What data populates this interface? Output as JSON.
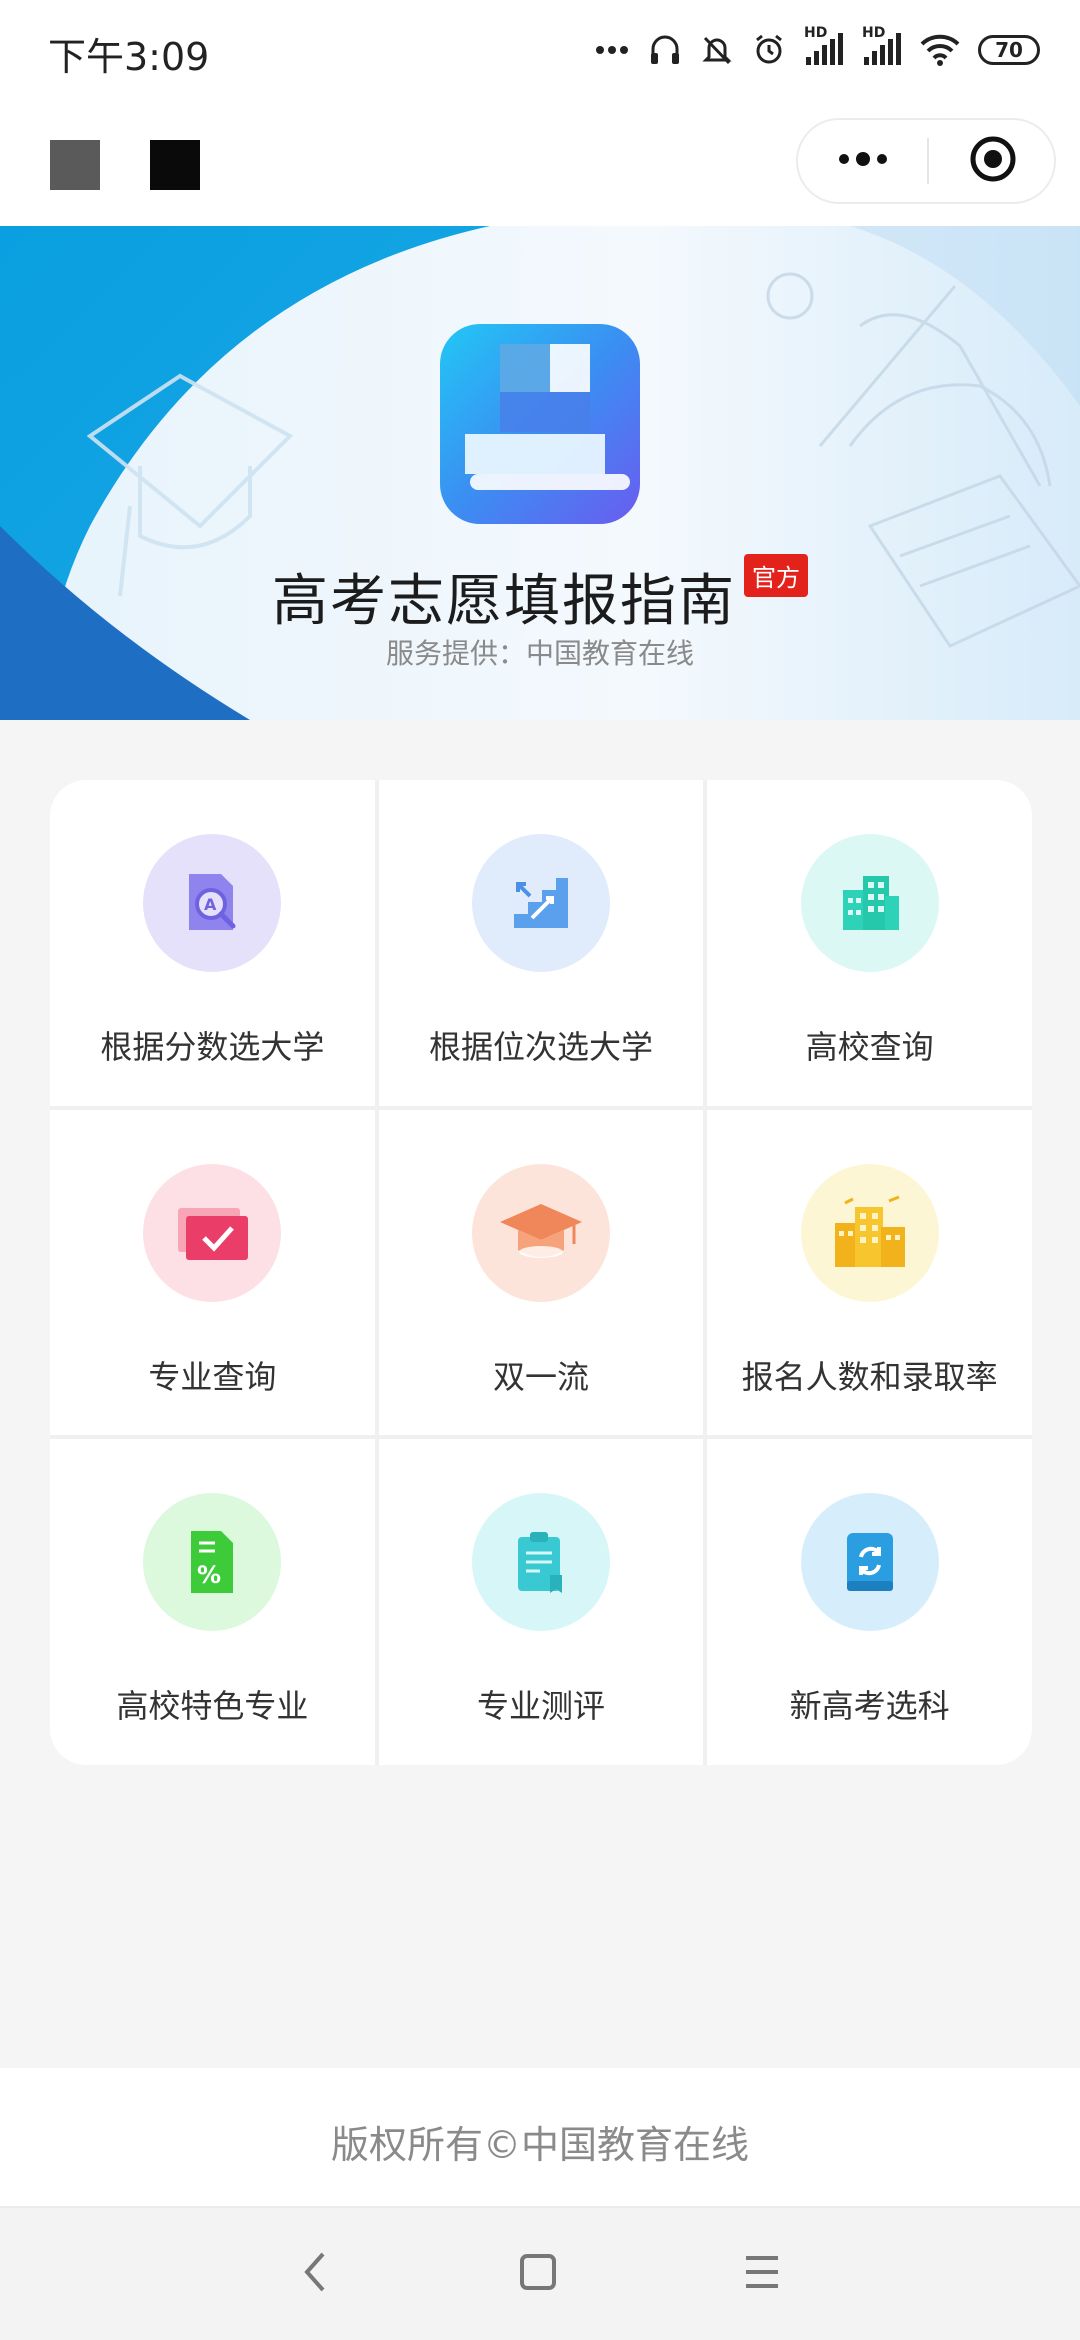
{
  "status_bar": {
    "time": "下午3:09",
    "battery": "70",
    "network_label_1": "HD",
    "network_label_2": "HD",
    "icons": [
      "more-dots-icon",
      "headphones-icon",
      "mute-bell-icon",
      "alarm-icon",
      "signal-icon",
      "signal-icon",
      "wifi-icon",
      "battery-icon"
    ]
  },
  "nav_bar": {
    "capsule_icons": [
      "more-icon",
      "close-target-icon"
    ]
  },
  "banner": {
    "title": "高考志愿填报指南",
    "badge": "官方",
    "subtitle": "服务提供：中国教育在线"
  },
  "menu": {
    "items": [
      {
        "label": "根据分数选大学",
        "icon": "score-search-icon",
        "bg": "#e6e1fb",
        "color": "#7b6ee8"
      },
      {
        "label": "根据位次选大学",
        "icon": "rank-stairs-icon",
        "bg": "#e0ecfb",
        "color": "#4a90e6"
      },
      {
        "label": "高校查询",
        "icon": "building-icon",
        "bg": "#dcf8f4",
        "color": "#27d1b5"
      },
      {
        "label": "专业查询",
        "icon": "checkbox-card-icon",
        "bg": "#fde0e6",
        "color": "#ea3e68"
      },
      {
        "label": "双一流",
        "icon": "graduation-cap-icon",
        "bg": "#fde4da",
        "color": "#f08a5c"
      },
      {
        "label": "报名人数和录取率",
        "icon": "city-building-icon",
        "bg": "#fdf6d4",
        "color": "#f2b21b"
      },
      {
        "label": "高校特色专业",
        "icon": "percent-document-icon",
        "bg": "#dcf8dd",
        "color": "#3ecb3a"
      },
      {
        "label": "专业测评",
        "icon": "clipboard-icon",
        "bg": "#d6f6f7",
        "color": "#2fc4cf"
      },
      {
        "label": "新高考选科",
        "icon": "refresh-book-icon",
        "bg": "#d6eefb",
        "color": "#2a9ee0"
      }
    ]
  },
  "footer": {
    "copyright": "版权所有©中国教育在线"
  },
  "system_nav": {
    "icons": [
      "back-icon",
      "home-icon",
      "menu-icon"
    ]
  }
}
